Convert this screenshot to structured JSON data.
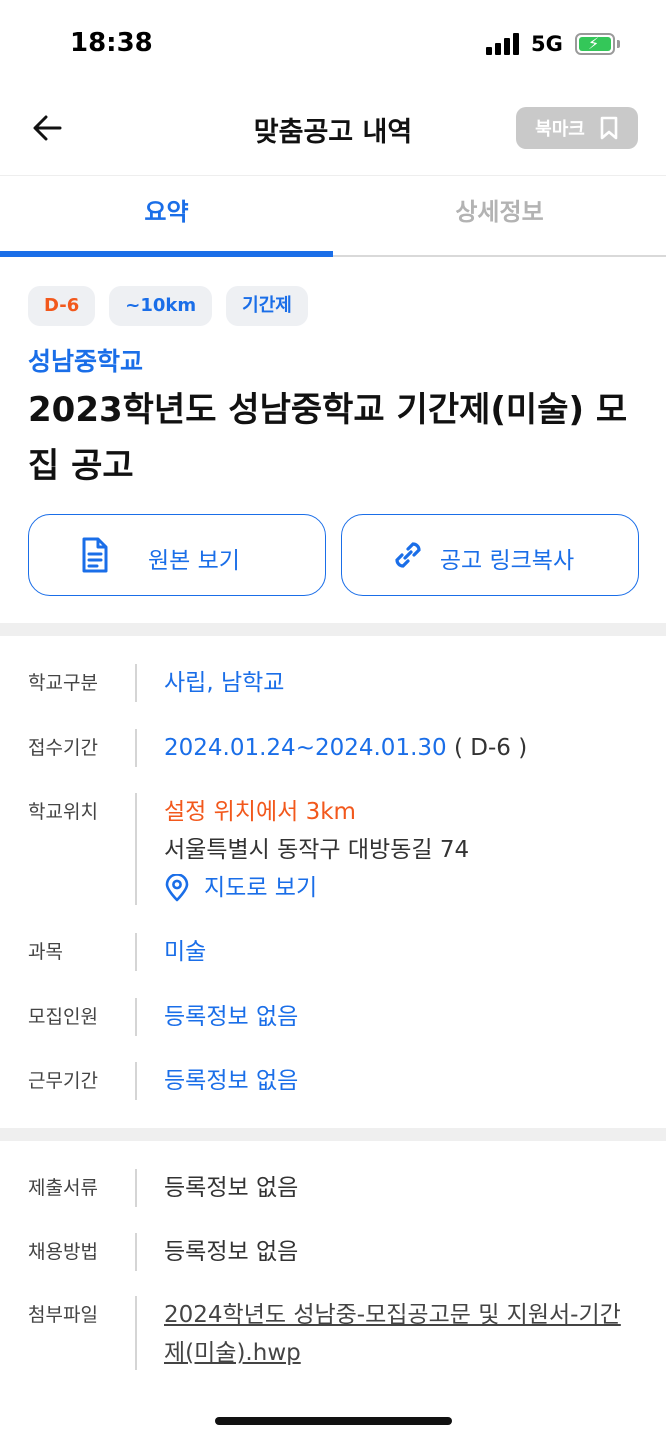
{
  "status": {
    "time": "18:38",
    "network": "5G"
  },
  "header": {
    "title": "맞춤공고 내역",
    "bookmark_label": "북마크"
  },
  "tabs": [
    {
      "label": "요약",
      "active": true
    },
    {
      "label": "상세정보",
      "active": false
    }
  ],
  "chips": {
    "dday": "D-6",
    "distance": "~10km",
    "type": "기간제"
  },
  "school_name": "성남중학교",
  "post_title": "2023학년도 성남중학교 기간제(미술) 모집 공고",
  "actions": {
    "original": "원본 보기",
    "copy_link": "공고 링크복사"
  },
  "info": {
    "school_type": {
      "label": "학교구분",
      "value": "사립, 남학교"
    },
    "period": {
      "label": "접수기간",
      "value": "2024.01.24~2024.01.30",
      "suffix": " ( D-6 )"
    },
    "location": {
      "label": "학교위치",
      "distance": "설정 위치에서 3km",
      "address": "서울특별시 동작구 대방동길 74",
      "map_link": "지도로 보기"
    },
    "subject": {
      "label": "과목",
      "value": "미술"
    },
    "headcount": {
      "label": "모집인원",
      "value": "등록정보 없음"
    },
    "work_period": {
      "label": "근무기간",
      "value": "등록정보 없음"
    }
  },
  "info2": {
    "documents": {
      "label": "제출서류",
      "value": "등록정보 없음"
    },
    "method": {
      "label": "채용방법",
      "value": "등록정보 없음"
    },
    "attachment": {
      "label": "첨부파일",
      "value": "2024학년도 성남중-모집공고문 및 지원서-기간제(미술).hwp"
    }
  },
  "colors": {
    "accent": "#1a6ee8",
    "dday": "#f2581c",
    "chip_bg": "#eef0f3"
  }
}
